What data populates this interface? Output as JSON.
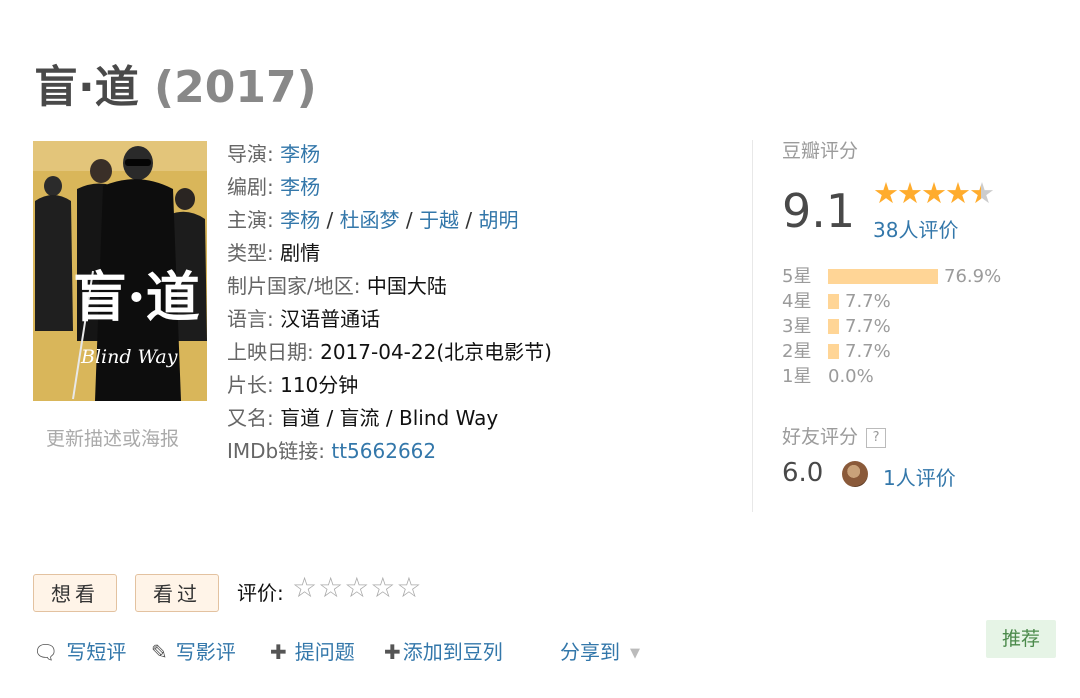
{
  "title": {
    "name": "盲·道",
    "year": "(2017)"
  },
  "poster": {
    "caption_cn": "盲·道",
    "caption_en": "Blind Way",
    "update_link": "更新描述或海报"
  },
  "info": {
    "director_label": "导演: ",
    "director": "李杨",
    "writer_label": "编剧: ",
    "writer": "李杨",
    "cast_label": "主演: ",
    "cast": [
      "李杨",
      "杜函梦",
      "于越",
      "胡明"
    ],
    "cast_sep": " / ",
    "genre_label": "类型: ",
    "genre": "剧情",
    "country_label": "制片国家/地区: ",
    "country": "中国大陆",
    "language_label": "语言: ",
    "language": "汉语普通话",
    "release_label": "上映日期: ",
    "release": "2017-04-22(北京电影节)",
    "runtime_label": "片长: ",
    "runtime": "110分钟",
    "aka_label": "又名: ",
    "aka": "盲道 / 盲流 / Blind Way",
    "imdb_label": "IMDb链接: ",
    "imdb": "tt5662662"
  },
  "rating": {
    "heading": "豆瓣评分",
    "score": "9.1",
    "stars_value": 4.5,
    "votes": "38人评价",
    "distribution": [
      {
        "label": "5星",
        "percent": 76.9,
        "text": "76.9%"
      },
      {
        "label": "4星",
        "percent": 7.7,
        "text": "7.7%"
      },
      {
        "label": "3星",
        "percent": 7.7,
        "text": "7.7%"
      },
      {
        "label": "2星",
        "percent": 7.7,
        "text": "7.7%"
      },
      {
        "label": "1星",
        "percent": 0.0,
        "text": "0.0%"
      }
    ],
    "friends_heading": "好友评分",
    "friends_help": "?",
    "friends_score": "6.0",
    "friends_votes": "1人评价"
  },
  "actions": {
    "want_label": "想看",
    "watched_label": "看过",
    "rate_label": "评价:",
    "rate_stars": "☆☆☆☆☆"
  },
  "links": {
    "short_review": "写短评",
    "review": "写影评",
    "question": "提问题",
    "add_list": "添加到豆列",
    "share": "分享到",
    "recommend": "推荐"
  },
  "colors": {
    "link": "#3377aa",
    "star": "#ffac2d",
    "bar": "#ffd596",
    "button_bg": "#fff4e8",
    "recommend_bg": "#e6f4e6"
  }
}
